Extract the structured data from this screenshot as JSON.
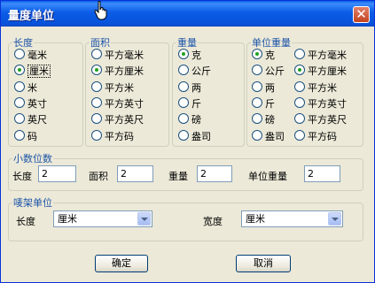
{
  "title": "量度单位",
  "groups": {
    "length": {
      "legend": "长度",
      "options": [
        "毫米",
        "厘米",
        "米",
        "英寸",
        "英尺",
        "码"
      ],
      "selected": "厘米"
    },
    "area": {
      "legend": "面积",
      "options": [
        "平方毫米",
        "平方厘米",
        "平方米",
        "平方英寸",
        "平方英尺",
        "平方码"
      ],
      "selected": "平方厘米"
    },
    "weight": {
      "legend": "重量",
      "options": [
        "克",
        "公斤",
        "两",
        "斤",
        "磅",
        "盎司"
      ],
      "selected": "克"
    },
    "unit_weight": {
      "legend": "单位重量",
      "left_options": [
        "克",
        "公斤",
        "两",
        "斤",
        "磅",
        "盎司"
      ],
      "right_options": [
        "平方毫米",
        "平方厘米",
        "平方米",
        "平方英寸",
        "平方英尺",
        "平方码"
      ],
      "left_selected": "克",
      "right_selected": "平方厘米"
    }
  },
  "decimals": {
    "legend": "小数位数",
    "length_label": "长度",
    "length_value": "2",
    "area_label": "面积",
    "area_value": "2",
    "weight_label": "重量",
    "weight_value": "2",
    "unit_weight_label": "单位重量",
    "unit_weight_value": "2"
  },
  "mark_unit": {
    "legend": "唛架单位",
    "length_label": "长度",
    "length_value": "厘米",
    "width_label": "宽度",
    "width_value": "厘米"
  },
  "buttons": {
    "ok": "确定",
    "cancel": "取消"
  }
}
